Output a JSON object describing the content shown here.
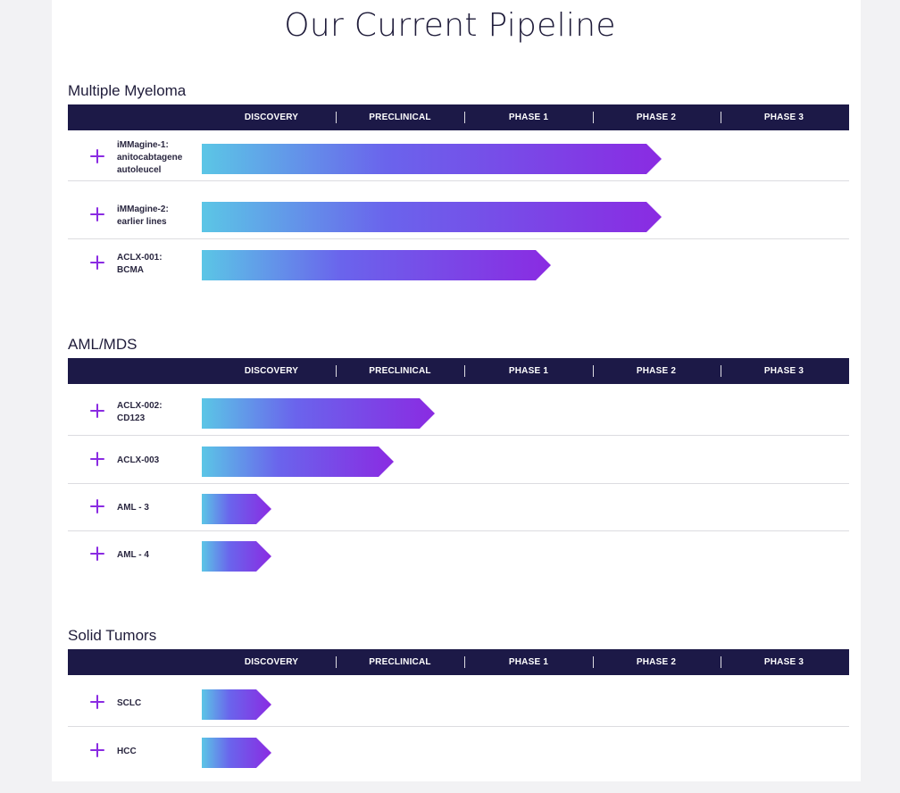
{
  "page": {
    "title": "Our Current Pipeline"
  },
  "phases": [
    "DISCOVERY",
    "PRECLINICAL",
    "PHASE 1",
    "PHASE 2",
    "PHASE 3"
  ],
  "colors": {
    "header_bar": "#1c1947",
    "plus_icon": "#8a2be2",
    "gradient_start": "#5bc6e6",
    "gradient_end": "#8a2be2"
  },
  "sections": [
    {
      "title": "Multiple Myeloma",
      "programs": [
        {
          "name": "iMMagine-1:\nanitocabtagene\nautoleucel",
          "progress": 0.79
        },
        {
          "name": "iMMagine-2:\nearlier lines",
          "progress": 0.79
        },
        {
          "name": "ACLX-001:\nBCMA",
          "progress": 0.6
        }
      ]
    },
    {
      "title": "AML/MDS",
      "programs": [
        {
          "name": "ACLX-002:\nCD123",
          "progress": 0.4
        },
        {
          "name": "ACLX-003",
          "progress": 0.33
        },
        {
          "name": "AML - 3",
          "progress": 0.12
        },
        {
          "name": "AML - 4",
          "progress": 0.12
        }
      ]
    },
    {
      "title": "Solid Tumors",
      "programs": [
        {
          "name": "SCLC",
          "progress": 0.12
        },
        {
          "name": "HCC",
          "progress": 0.12
        }
      ]
    }
  ]
}
